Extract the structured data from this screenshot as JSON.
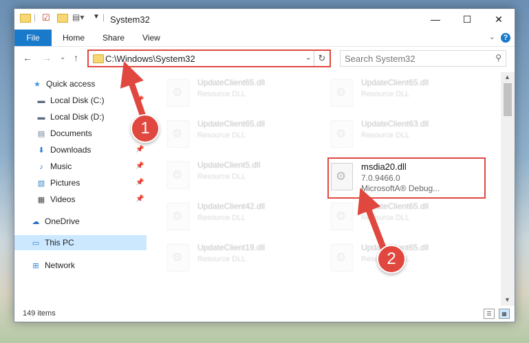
{
  "window": {
    "title": "System32",
    "controls": {
      "minimize": "—",
      "maximize": "☐",
      "close": "✕"
    }
  },
  "ribbon": {
    "file": "File",
    "tabs": [
      "Home",
      "Share",
      "View"
    ],
    "help": "?"
  },
  "nav": {
    "address": "C:\\Windows\\System32",
    "search_placeholder": "Search System32"
  },
  "sidebar": {
    "items": [
      {
        "label": "Quick access",
        "icon": "star-icon"
      },
      {
        "label": "Local Disk (C:)",
        "icon": "drive-icon"
      },
      {
        "label": "Local Disk (D:)",
        "icon": "drive-icon"
      },
      {
        "label": "Documents",
        "icon": "documents-icon"
      },
      {
        "label": "Downloads",
        "icon": "download-icon"
      },
      {
        "label": "Music",
        "icon": "music-icon"
      },
      {
        "label": "Pictures",
        "icon": "pictures-icon"
      },
      {
        "label": "Videos",
        "icon": "videos-icon"
      },
      {
        "label": "OneDrive",
        "icon": "cloud-icon"
      },
      {
        "label": "This PC",
        "icon": "pc-icon"
      },
      {
        "label": "Network",
        "icon": "network-icon"
      }
    ]
  },
  "files": [
    {
      "name": "UpdateClient65.dll",
      "desc": "Resource DLL"
    },
    {
      "name": "UpdateClient65.dll",
      "desc": "Resource DLL"
    },
    {
      "name": "UpdateClient65.dll",
      "desc": "Resource DLL"
    },
    {
      "name": "UpdateClient63.dll",
      "desc": "Resource DLL"
    },
    {
      "name": "UpdateClient5.dll",
      "desc": "Resource DLL"
    },
    {
      "name": "UpdateClient42.dll",
      "desc": "Resource DLL"
    },
    {
      "name": "UpdateClient65.dll",
      "desc": "Resource DLL"
    },
    {
      "name": "UpdateClient19.dll",
      "desc": "Resource DLL"
    },
    {
      "name": "UpdateClient65.dll",
      "desc": "Resource DLL"
    }
  ],
  "highlighted_file": {
    "name": "msdia20.dll",
    "version": "7.0.9466.0",
    "description": "MicrosoftA® Debug..."
  },
  "status": {
    "count": "149 items"
  },
  "annotations": {
    "step1": "1",
    "step2": "2",
    "color": "#e0473f"
  }
}
